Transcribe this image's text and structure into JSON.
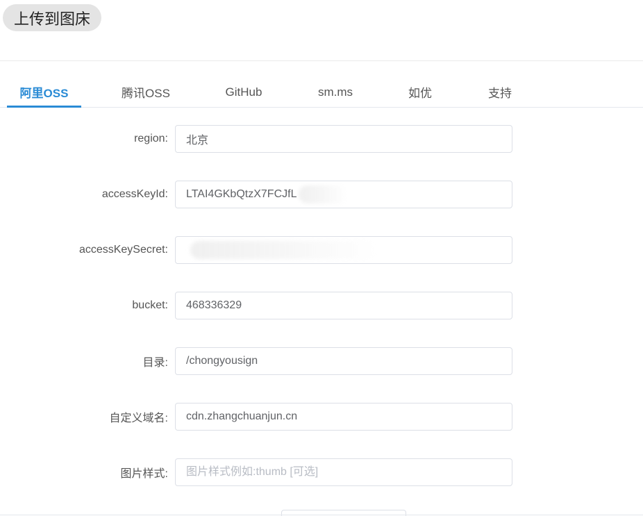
{
  "header": {
    "upload_button": "上传到图床"
  },
  "tabs": [
    {
      "label": "阿里OSS",
      "active": true
    },
    {
      "label": "腾讯OSS",
      "active": false
    },
    {
      "label": "GitHub",
      "active": false
    },
    {
      "label": "sm.ms",
      "active": false
    },
    {
      "label": "如优",
      "active": false
    },
    {
      "label": "支持",
      "active": false
    }
  ],
  "form": {
    "region": {
      "label": "region:",
      "value": "北京"
    },
    "accessKeyId": {
      "label": "accessKeyId:",
      "value": "LTAI4GKbQtzX7FCJfL"
    },
    "accessKeySecret": {
      "label": "accessKeySecret:",
      "value": ""
    },
    "bucket": {
      "label": "bucket:",
      "value": "468336329"
    },
    "directory": {
      "label": "目录:",
      "value": "/chongyousign"
    },
    "custom_domain": {
      "label": "自定义域名:",
      "value": "cdn.zhangchuanjun.cn"
    },
    "image_style": {
      "label": "图片样式:",
      "value": "",
      "placeholder": "图片样式例如:thumb [可选]"
    }
  },
  "colors": {
    "accent": "#2a8bd5",
    "border": "#dcdfe6"
  }
}
